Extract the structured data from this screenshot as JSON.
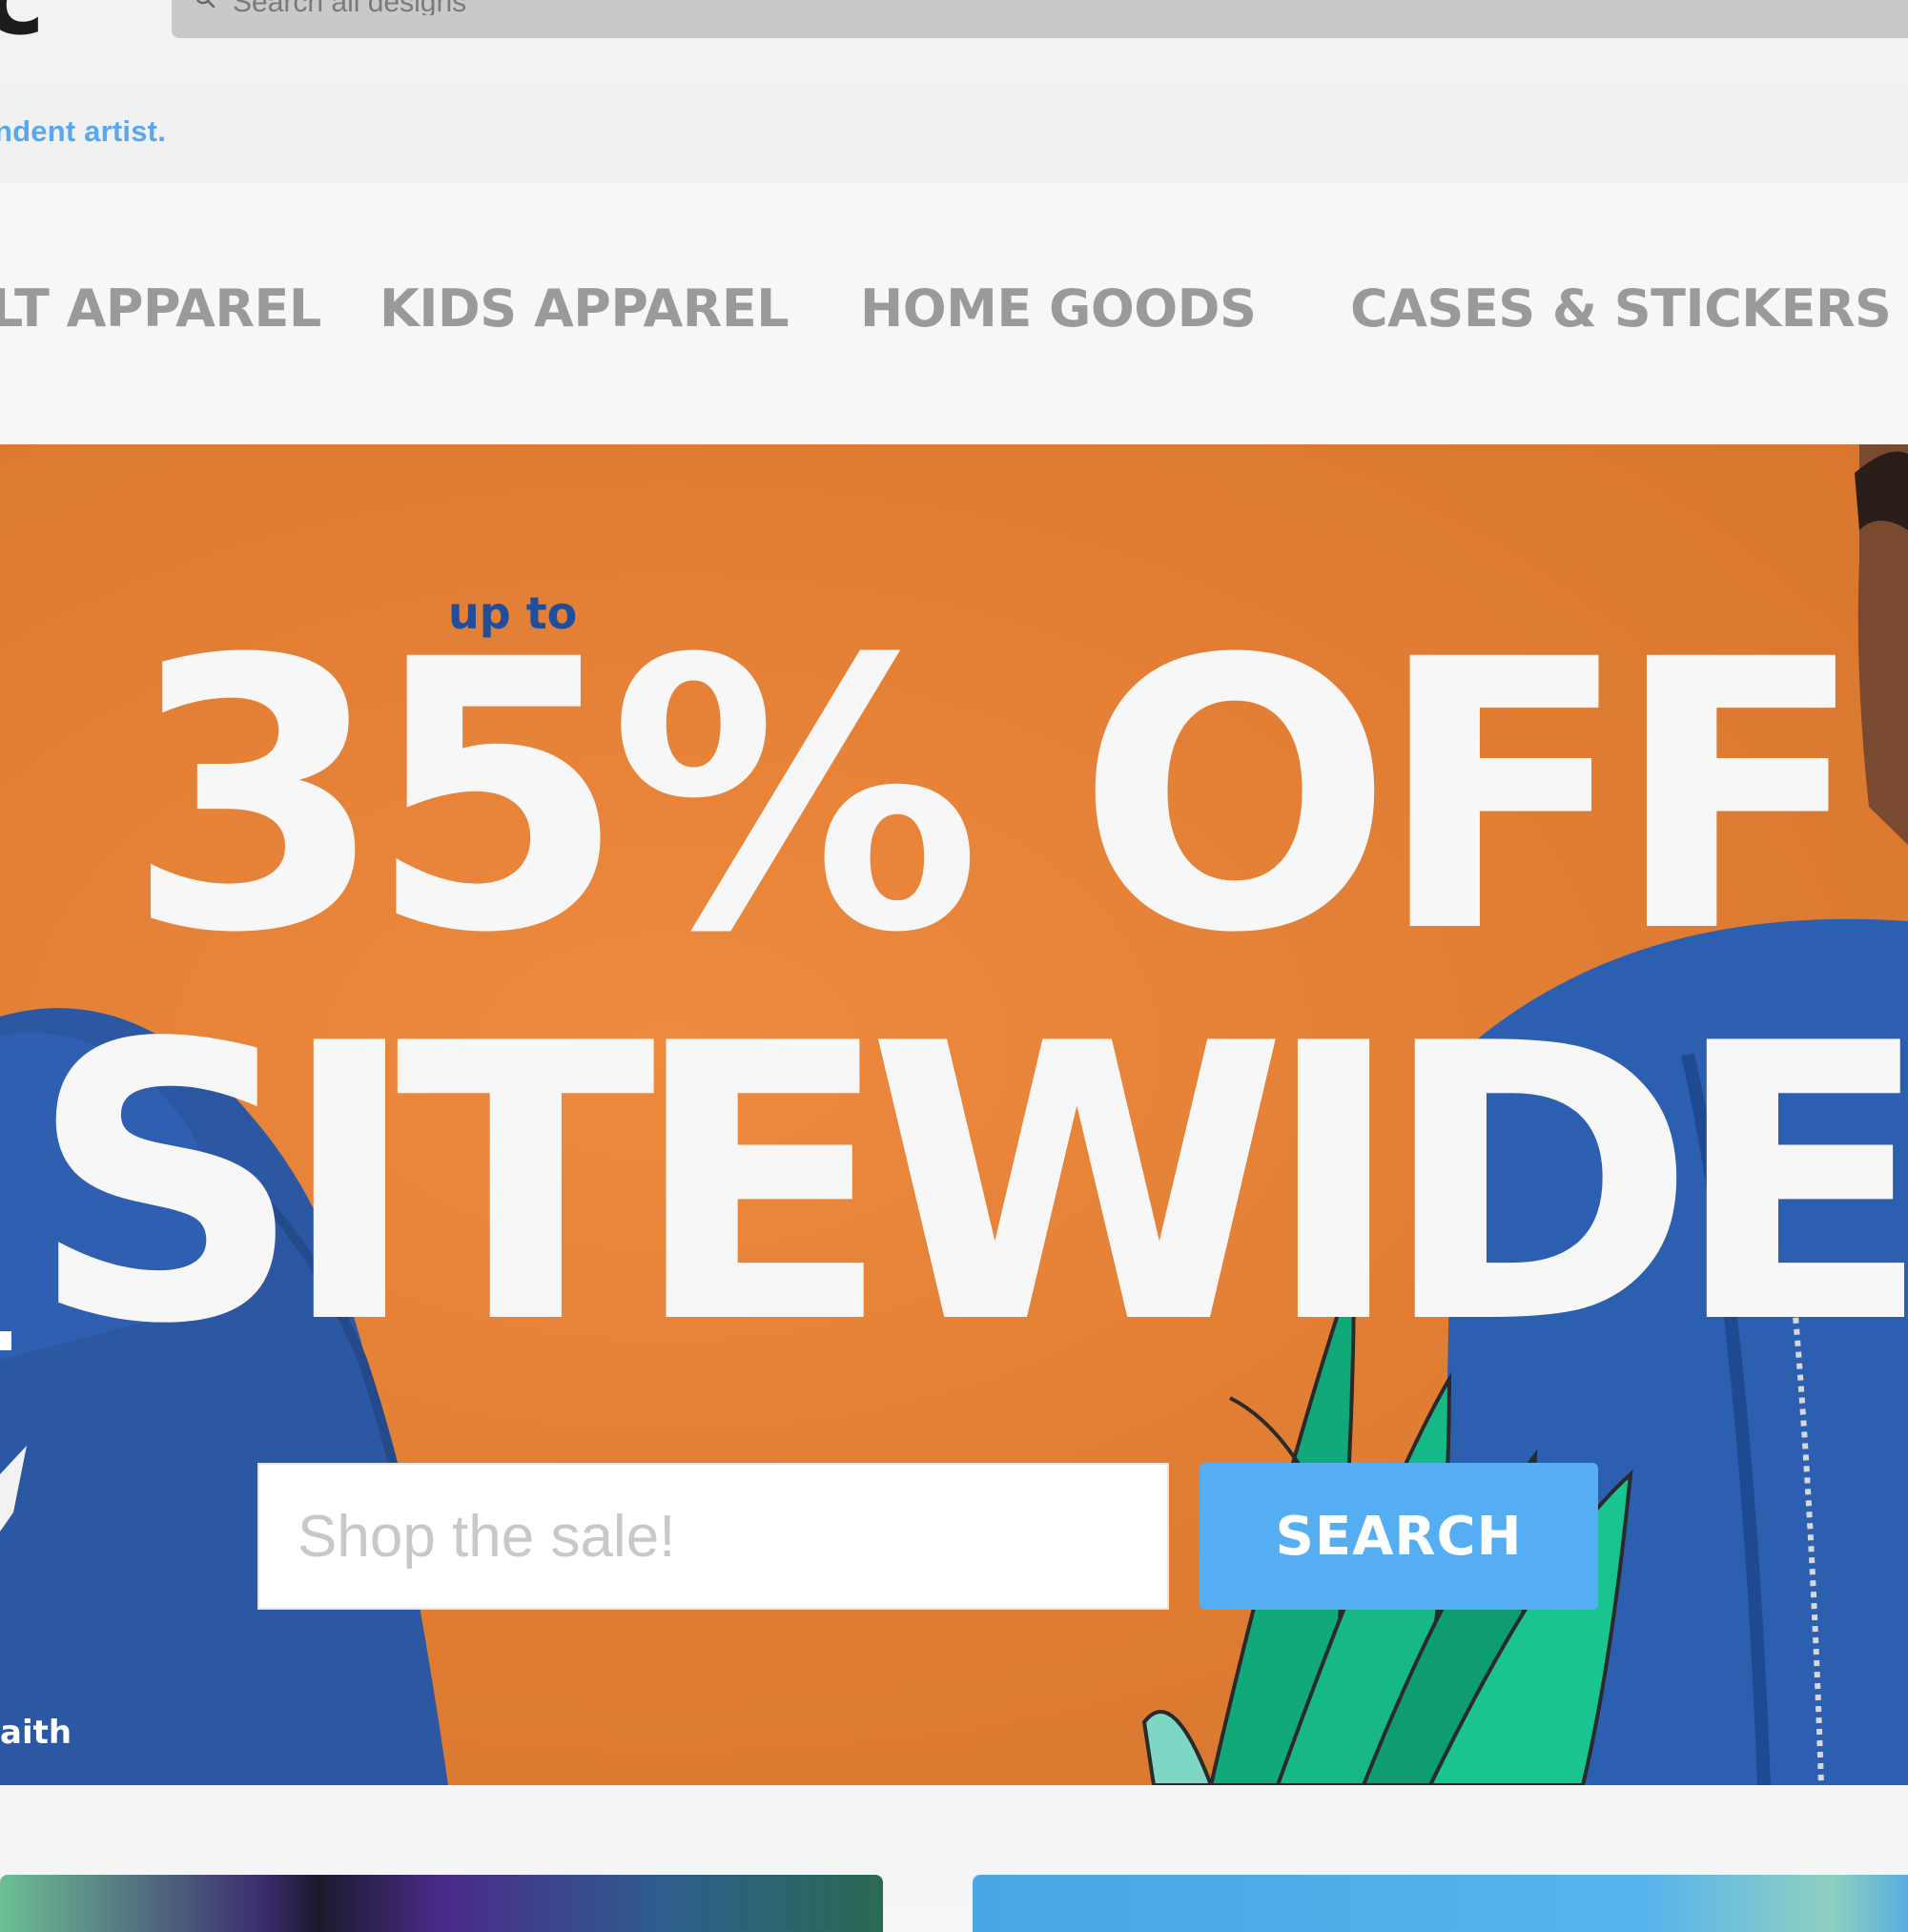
{
  "header": {
    "logo_fragment": "c",
    "search": {
      "placeholder": "Search all designs",
      "icon": "search-icon"
    }
  },
  "tagline": "ndent artist.",
  "nav": {
    "items": [
      {
        "label": "LT APPAREL"
      },
      {
        "label": "KIDS APPAREL"
      },
      {
        "label": "HOME GOODS"
      },
      {
        "label": "CASES & STICKERS"
      }
    ]
  },
  "hero": {
    "up_to": "up to",
    "headline_line1": "35% OFF",
    "headline_line2": "SITEWIDE",
    "left_artist_fragment": "aith",
    "search_placeholder": "Shop the sale!",
    "search_button": "SEARCH",
    "colors": {
      "background": "#e07d33",
      "headline": "#f7f7f7",
      "up_to": "#1f4f9c",
      "button": "#55aef2"
    }
  }
}
